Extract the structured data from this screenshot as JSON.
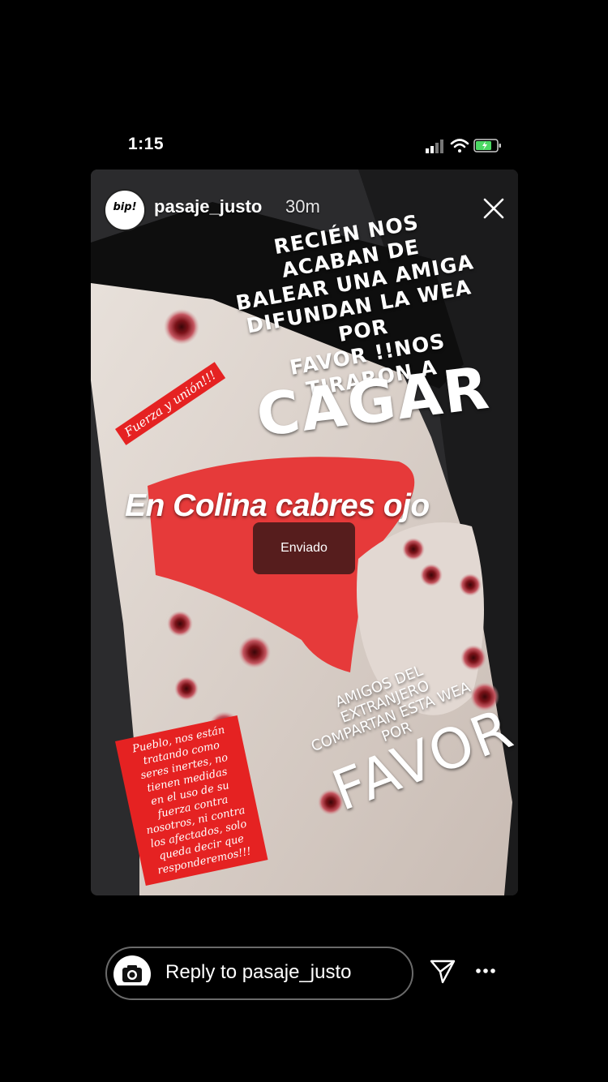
{
  "status_bar": {
    "time": "1:15",
    "battery_color": "#4cd964"
  },
  "story": {
    "username": "pasaje_justo",
    "time_ago": "30m",
    "avatar_text": "bip!",
    "progress_fraction": 0.62,
    "overlay": {
      "main": "RECIÉN NOS ACABAN DE\nBALEAR UNA AMIGA\nDIFUNDAN LA WEA POR\nFAVOR !!NOS TIRARON A",
      "big1": "CAGAR",
      "colina": "En Colina cabres ojo",
      "friends": "AMIGOS DEL EXTRANJERO\nCOMPARTAN ESTA WEA POR",
      "big2": "FAVOR"
    },
    "tags": {
      "tag1": "Fuerza y unión!!!",
      "tag2": "Pueblo, nos están\ntratando como\nseres inertes, no\ntienen medidas\nen el uso de su\nfuerza contra\nnosotros, ni contra\nlos afectados, solo\nqueda decir que\nresponderemos!!!"
    },
    "sent_label": "Enviado"
  },
  "reply_bar": {
    "placeholder": "Reply to pasaje_justo"
  }
}
